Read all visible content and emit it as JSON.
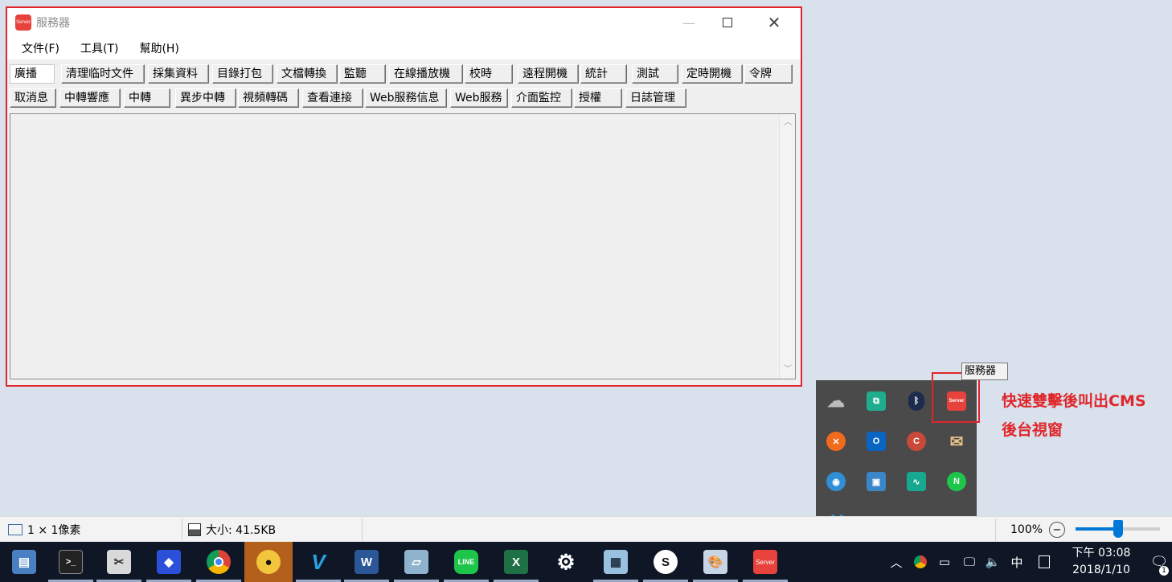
{
  "window": {
    "title": "服務器",
    "icon_text": "Server",
    "menus": [
      "文件(F)",
      "工具(T)",
      "幫助(H)"
    ],
    "toolbar_row1": [
      "廣播",
      "清理临时文件",
      "採集資料",
      "目錄打包",
      "文檔轉換",
      "監聽",
      "在線播放機",
      "校時",
      "遠程開機",
      "統計",
      "測試",
      "定時開機",
      "令牌"
    ],
    "toolbar_row2": [
      "取消息",
      "中轉響應",
      "中轉",
      "異步中轉",
      "視頻轉碼",
      "查看連接",
      "Web服務信息",
      "Web服務",
      "介面監控",
      "授權",
      "日誌管理"
    ],
    "selected_button": "廣播"
  },
  "tray": {
    "tooltip": "服務器",
    "icons": [
      "onedrive-icon",
      "greenshot-icon",
      "bluetooth-icon",
      "server-icon",
      "avast-icon",
      "outlook-icon",
      "ccleaner-icon",
      "mail-icon",
      "network-chat-icon",
      "remote-desktop-icon",
      "activity-monitor-icon",
      "line-notify-icon",
      "v-app-icon"
    ],
    "server_icon_text": "Server"
  },
  "annotation": {
    "line1": "快速雙擊後叫出CMS",
    "line2": "後台視窗"
  },
  "statusbar": {
    "dimensions": "1 × 1像素",
    "size": "大小: 41.5KB",
    "zoom": "100%",
    "zoom_minus": "−",
    "zoom_level": 0.5
  },
  "taskbar": {
    "apps": [
      "file-explorer-icon",
      "terminal-icon",
      "tools-icon",
      "dropbox-icon",
      "chrome-icon",
      "penguin-app-icon",
      "v-app-icon",
      "word-icon",
      "notebook-icon",
      "line-icon",
      "excel-icon",
      "settings-icon",
      "display-icon",
      "skype-icon",
      "paint-icon",
      "server-icon"
    ],
    "server_text": "Server",
    "ime": "中",
    "time": "下午 03:08",
    "date": "2018/1/10",
    "notification_count": "1"
  },
  "colors": {
    "highlight": "#e0262b",
    "taskbar": "#0f1626",
    "accent": "#0078d7",
    "server_red": "#e7423b"
  }
}
